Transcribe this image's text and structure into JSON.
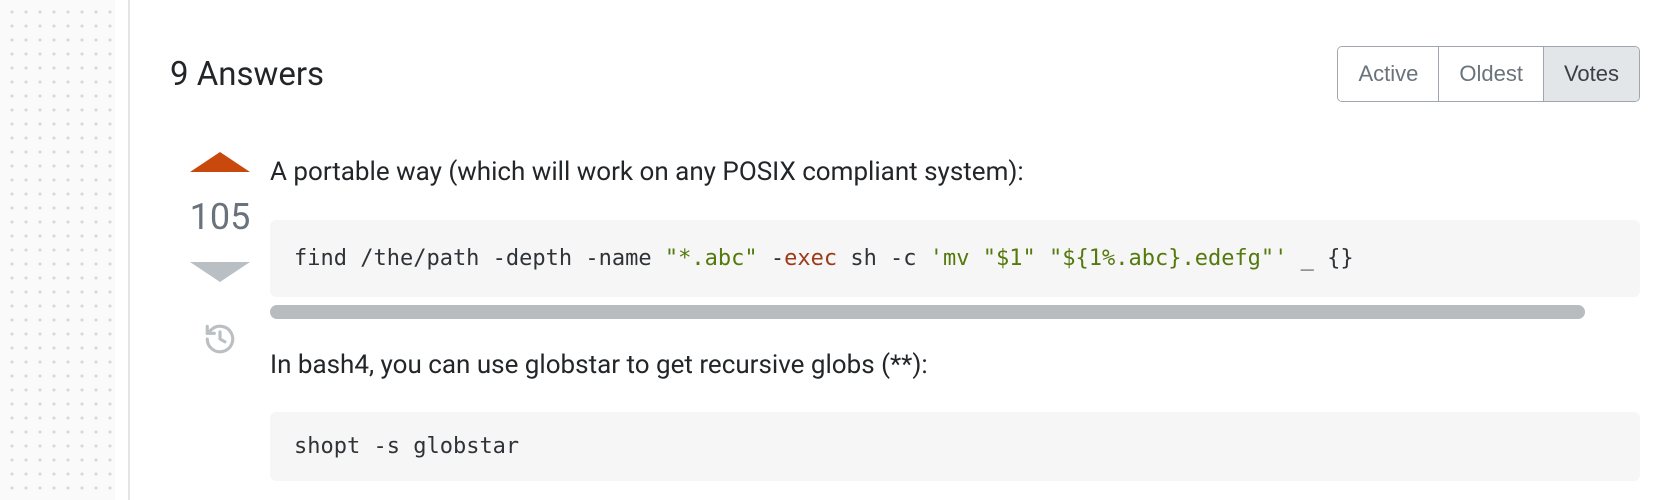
{
  "header": {
    "title": "9 Answers",
    "sort_tabs": {
      "active": "Active",
      "oldest": "Oldest",
      "votes": "Votes"
    }
  },
  "answer": {
    "vote_count": "105",
    "intro_text": "A portable way (which will work on any POSIX compliant system):",
    "code1": {
      "p1": "find /the/path -depth -name ",
      "s1": "\"*.abc\"",
      "p2": " -",
      "kw": "exec",
      "p3": " sh -c ",
      "s2": "'mv \"$1\" \"${1%.abc}.edefg\"'",
      "p4": " _ {}"
    },
    "para2": "In bash4, you can use globstar to get recursive globs (**):",
    "code2": {
      "kw": "shopt",
      "rest": " -s globstar"
    }
  }
}
